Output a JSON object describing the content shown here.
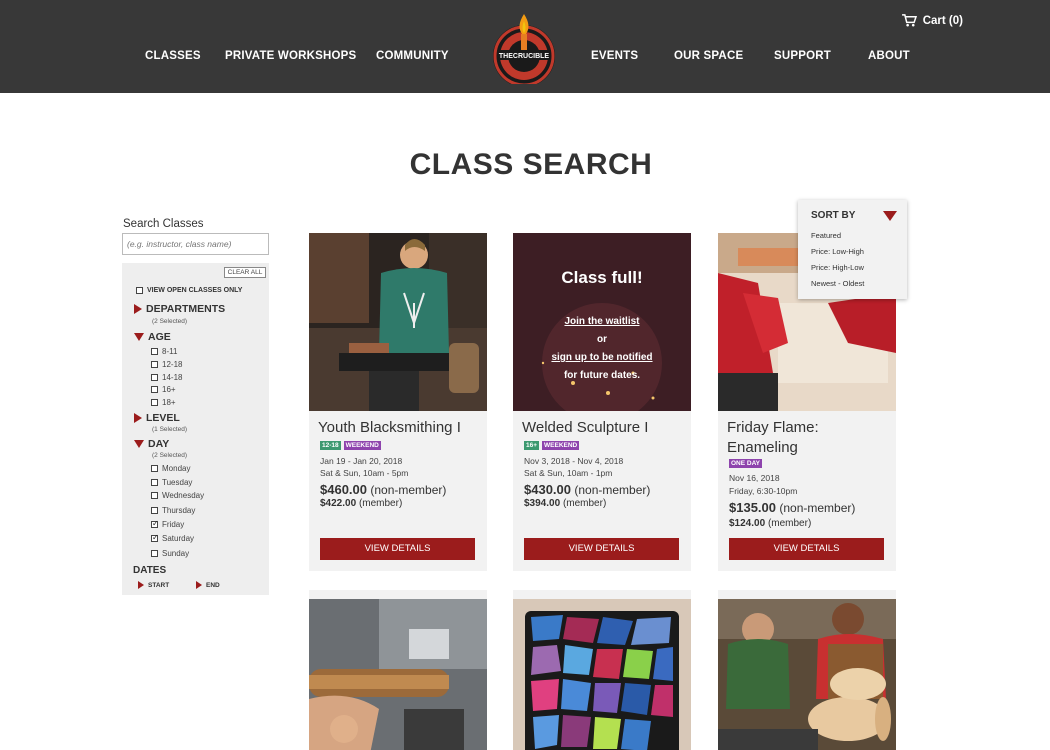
{
  "header": {
    "nav": [
      "CLASSES",
      "PRIVATE WORKSHOPS",
      "COMMUNITY",
      "EVENTS",
      "OUR SPACE",
      "SUPPORT",
      "ABOUT"
    ],
    "cart_label": "Cart (0)",
    "logo_text": "THECRUCIBLE"
  },
  "page": {
    "title": "CLASS SEARCH"
  },
  "sidebar": {
    "search_label": "Search Classes",
    "search_placeholder": "(e.g. instructor, class name)",
    "clear_all": "CLEAR ALL",
    "open_only": "VIEW OPEN CLASSES ONLY",
    "departments": {
      "label": "DEPARTMENTS",
      "sub": "(2 Selected)"
    },
    "age": {
      "label": "AGE",
      "options": [
        "8-11",
        "12-18",
        "14-18",
        "16+",
        "18+"
      ]
    },
    "level": {
      "label": "LEVEL",
      "sub": "(1 Selected)"
    },
    "day": {
      "label": "DAY",
      "sub": "(2 Selected)",
      "options": [
        "Monday",
        "Tuesday",
        "Wednesday",
        "Thursday",
        "Friday",
        "Saturday",
        "Sunday"
      ],
      "checked": [
        false,
        false,
        false,
        false,
        true,
        true,
        false
      ]
    },
    "dates": {
      "label": "DATES",
      "start": "START",
      "end": "END"
    }
  },
  "sort": {
    "label": "SORT BY",
    "options": [
      "Featured",
      "Price: Low-High",
      "Price: High-Low",
      "Newest - Oldest"
    ]
  },
  "cards": [
    {
      "title": "Youth Blacksmithing I",
      "badges": [
        "12-18",
        "WEEKEND"
      ],
      "dates": "Jan 19 - Jan 20, 2018",
      "time": "Sat & Sun, 10am - 5pm",
      "price_nonmember": "$460.00",
      "nonmember_suffix": "(non-member)",
      "price_member": "$422.00",
      "member_suffix": "(member)",
      "button": "VIEW DETAILS"
    },
    {
      "title": "Welded Sculpture I",
      "badges": [
        "16+",
        "WEEKEND"
      ],
      "dates": "Nov 3, 2018 - Nov 4, 2018",
      "time": "Sat & Sun, 10am - 1pm",
      "price_nonmember": "$430.00",
      "nonmember_suffix": "(non-member)",
      "price_member": "$394.00",
      "member_suffix": "(member)",
      "button": "VIEW DETAILS",
      "overlay": {
        "heading": "Class full!",
        "line1": "Join the waitlist",
        "line2": "or",
        "line3": "sign up to be notified",
        "line4": "for future dates."
      }
    },
    {
      "title": "Friday Flame: Enameling",
      "badges": [
        "ONE DAY"
      ],
      "dates": "Nov 16, 2018",
      "time": "Friday, 6:30-10pm",
      "price_nonmember": "$135.00",
      "nonmember_suffix": "(non-member)",
      "price_member": "$124.00",
      "member_suffix": "(member)",
      "button": "VIEW DETAILS"
    }
  ],
  "colors": {
    "accent": "#9b1c1c",
    "header_bg": "#383838",
    "badge_age": "#3d9970",
    "badge_purple": "#8e44ad"
  }
}
